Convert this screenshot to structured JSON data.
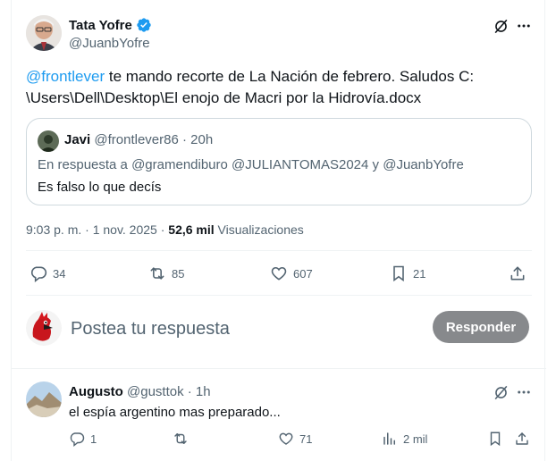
{
  "main_tweet": {
    "author_name": "Tata Yofre",
    "author_handle": "@JuanbYofre",
    "mention": "@frontlever",
    "text_line1": " te mando recorte de La Nación de febrero. Saludos  C:",
    "text_line2": "\\Users\\Dell\\Desktop\\El enojo de Macri por la Hidrovía.docx",
    "timestamp": "9:03 p. m. · 1 nov. 2025 · ",
    "views_count": "52,6 mil",
    "views_label": " Visualizaciones"
  },
  "quoted": {
    "author_name": "Javi",
    "author_handle": "@frontlever86",
    "time": "· 20h",
    "reply_prefix": "En respuesta a ",
    "reply_handles_1": "@gramendiburo @JULIANTOMAS2024",
    "reply_and": " y ",
    "reply_handles_2": "@JuanbYofre",
    "text": "Es falso lo que decís"
  },
  "actions": {
    "replies": "34",
    "retweets": "85",
    "likes": "607",
    "bookmarks": "21"
  },
  "composer": {
    "placeholder": "Postea tu respuesta",
    "button_label": "Responder"
  },
  "reply": {
    "author_name": "Augusto",
    "author_handle": "@gusttok",
    "time": "· 1h",
    "text": "el espía argentino mas preparado...",
    "replies": "1",
    "retweets": "",
    "likes": "71",
    "views": "2 mil"
  },
  "colors": {
    "accent": "#1d9bf0",
    "text": "#0f1419",
    "muted": "#536471",
    "button_bg": "#87898c"
  }
}
